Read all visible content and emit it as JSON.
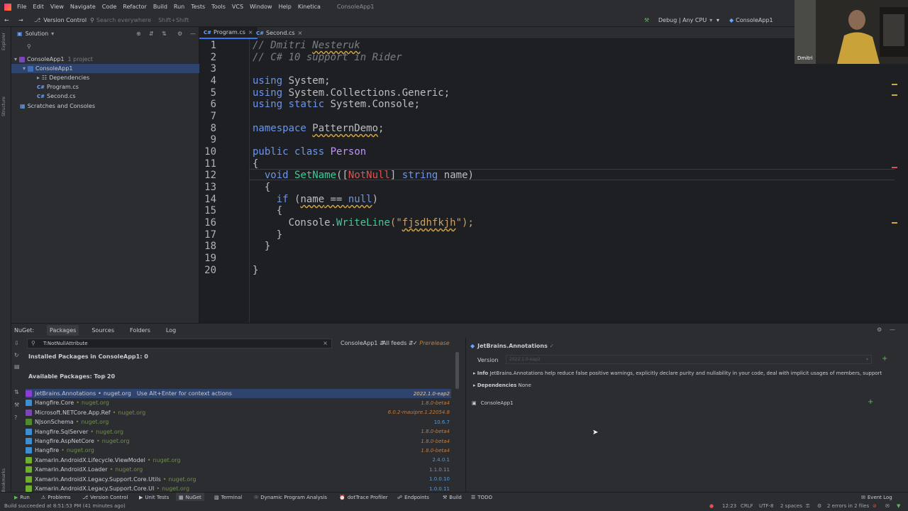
{
  "menubar": {
    "items": [
      "File",
      "Edit",
      "View",
      "Navigate",
      "Code",
      "Refactor",
      "Build",
      "Run",
      "Tests",
      "Tools",
      "VCS",
      "Window",
      "Help",
      "Kinetica"
    ],
    "project_title": "ConsoleApp1"
  },
  "toolbar": {
    "version_control": "Version Control",
    "search_placeholder": "Search everywhere",
    "search_shortcut": "Shift+Shift",
    "config": "Debug | Any CPU",
    "run_target": "ConsoleApp1"
  },
  "left_strip": {
    "labels": [
      "Explorer",
      "Structure",
      "Bookmarks"
    ]
  },
  "explorer": {
    "title": "Solution",
    "tree": [
      {
        "label": "ConsoleApp1",
        "note": "1 project"
      },
      {
        "label": "ConsoleApp1"
      },
      {
        "label": "Dependencies"
      },
      {
        "label": "Program.cs",
        "prefix": "C#"
      },
      {
        "label": "Second.cs",
        "prefix": "C#"
      },
      {
        "label": "Scratches and Consoles"
      }
    ]
  },
  "editor": {
    "tabs": [
      {
        "prefix": "C#",
        "label": "Program.cs"
      },
      {
        "prefix": "C#",
        "label": "Second.cs"
      }
    ],
    "line_numbers": [
      "1",
      "2",
      "3",
      "4",
      "5",
      "6",
      "7",
      "8",
      "9",
      "10",
      "11",
      "12",
      "13",
      "14",
      "15",
      "16",
      "17",
      "18",
      "19",
      "20"
    ],
    "code": {
      "l1": "// Dmitri ",
      "l1b": "Nesteruk",
      "l2": "// C# 10 support in Rider",
      "using_kw": "using",
      "l4": " System;",
      "l5": " System.Collections.Generic;",
      "static_kw": "static",
      "l6": " System.Console;",
      "namespace_kw": "namespace",
      "ns_name": "PatternDemo",
      "semicolon": ";",
      "public_kw": "public",
      "class_kw": "class",
      "class_name": "Person",
      "open_brace": "{",
      "close_brace": "}",
      "void_kw": "void",
      "method": "SetName",
      "paren_open": "([",
      "attr": "NotNull",
      "bracket_close": "]",
      "string_kw": "string",
      "param": "name",
      "paren_close": ")",
      "if_kw": "if",
      "if_open": " (",
      "cond_var": "name",
      "eq": " == ",
      "null_kw": "null",
      "console": "Console",
      "dot": ".",
      "writeline": "WriteLine",
      "str_open": "(\"",
      "str_val": "fjsdhfkjh",
      "str_close": "\");"
    }
  },
  "nuget": {
    "tabs": [
      "NuGet:",
      "Packages",
      "Sources",
      "Folders",
      "Log"
    ],
    "search_value": "T:NotNullAttribute",
    "project_filter": "ConsoleApp1",
    "feeds_filter": "All feeds",
    "prerelease_label": "Prerelease",
    "installed_header": "Installed Packages in ConsoleApp1: 0",
    "available_header": "Available Packages: Top 20",
    "packages": [
      {
        "name": "JetBrains.Annotations",
        "source": "nuget.org",
        "version": "2022.1.0-eap2",
        "hint": "Use Alt+Enter for context actions",
        "prerelease": true,
        "color": "#8a3fd1"
      },
      {
        "name": "Hangfire.Core",
        "source": "nuget.org",
        "version": "1.8.0-beta4",
        "prerelease": true,
        "color": "#3d8fd1"
      },
      {
        "name": "Microsoft.NETCore.App.Ref",
        "source": "nuget.org",
        "version": "6.0.2-mauipre.1.22054.8",
        "prerelease": true,
        "color": "#7b46b7"
      },
      {
        "name": "NJsonSchema",
        "source": "nuget.org",
        "version": "10.6.7",
        "prerelease": false,
        "color": "#4f8a2f"
      },
      {
        "name": "Hangfire.SqlServer",
        "source": "nuget.org",
        "version": "1.8.0-beta4",
        "prerelease": true,
        "color": "#3d8fd1"
      },
      {
        "name": "Hangfire.AspNetCore",
        "source": "nuget.org",
        "version": "1.8.0-beta4",
        "prerelease": true,
        "color": "#3d8fd1"
      },
      {
        "name": "Hangfire",
        "source": "nuget.org",
        "version": "1.8.0-beta4",
        "prerelease": true,
        "color": "#3d8fd1"
      },
      {
        "name": "Xamarin.AndroidX.Lifecycle.ViewModel",
        "source": "nuget.org",
        "version": "2.4.0.1",
        "prerelease": false,
        "color": "#6fae2e"
      },
      {
        "name": "Xamarin.AndroidX.Loader",
        "source": "nuget.org",
        "version": "1.1.0.11",
        "prerelease": false,
        "color": "#6fae2e"
      },
      {
        "name": "Xamarin.AndroidX.Legacy.Support.Core.Utils",
        "source": "nuget.org",
        "version": "1.0.0.10",
        "prerelease": false,
        "color": "#6fae2e"
      },
      {
        "name": "Xamarin.AndroidX.Legacy.Support.Core.UI",
        "source": "nuget.org",
        "version": "1.0.0.11",
        "prerelease": false,
        "color": "#6fae2e"
      }
    ],
    "detail": {
      "package": "JetBrains.Annotations",
      "version_label": "Version",
      "version_value": "2022.1.0-eap2",
      "info_label": "Info",
      "info_text": "JetBrains.Annotations help reduce false positive warnings, explicitly declare purity and nullability in your code, deal with implicit usages of members, support",
      "deps_label": "Dependencies",
      "deps_value": "None",
      "project": "ConsoleApp1"
    }
  },
  "toolwindows": [
    "Run",
    "Problems",
    "Version Control",
    "Unit Tests",
    "NuGet",
    "Terminal",
    "Dynamic Program Analysis",
    "dotTrace Profiler",
    "Endpoints",
    "Build",
    "TODO",
    "Event Log"
  ],
  "status": {
    "message": "Build succeeded at 8:51:53 PM (41 minutes ago)",
    "time": "12:23",
    "line_sep": "CRLF",
    "encoding": "UTF-8",
    "indent": "2 spaces",
    "errors": "2 errors in 2 files"
  },
  "webcam": {
    "name": "Dmitri"
  },
  "colors": {
    "accent": "#3574f0",
    "selection": "#2e436e",
    "prerelease": "#c77c3a"
  }
}
